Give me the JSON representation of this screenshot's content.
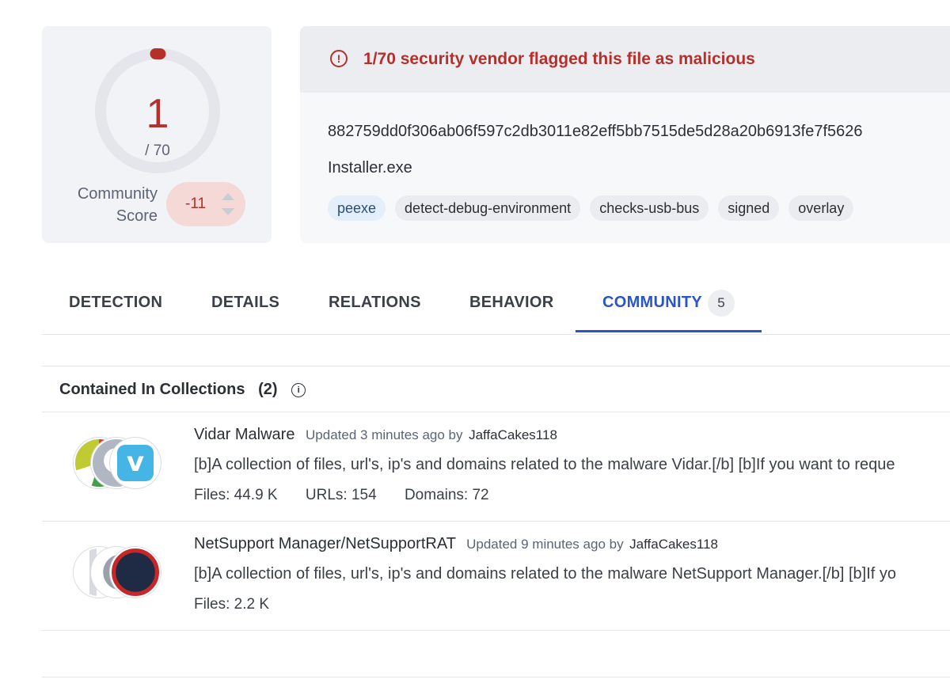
{
  "score": {
    "detections": "1",
    "total": "/ 70",
    "community_label": "Community Score",
    "community_value": "-11",
    "accent_color": "#b5302b"
  },
  "alert": {
    "icon": "alert-circle-icon",
    "text": "1/70 security vendor flagged this file as malicious"
  },
  "file": {
    "hash": "882759dd0f306ab06f597c2db3011e82eff5bb7515de5d28a20b6913fe7f5626",
    "name": "Installer.exe",
    "tags": [
      "peexe",
      "detect-debug-environment",
      "checks-usb-bus",
      "signed",
      "overlay"
    ]
  },
  "tabs": {
    "detection": "DETECTION",
    "details": "DETAILS",
    "relations": "RELATIONS",
    "behavior": "BEHAVIOR",
    "community": "COMMUNITY",
    "community_count": "5",
    "active": "COMMUNITY"
  },
  "collections": {
    "header": "Contained In Collections",
    "count": "(2)",
    "items": [
      {
        "name": "Vidar Malware",
        "updated": "Updated 3 minutes ago by",
        "author": "JaffaCakes118",
        "description": "[b]A collection of files, url's, ip's and domains related to the malware Vidar.[/b] [b]If you want to reque",
        "files": "Files: 44.9 K",
        "urls": "URLs: 154",
        "domains": "Domains: 72"
      },
      {
        "name": "NetSupport Manager/NetSupportRAT",
        "updated": "Updated 9 minutes ago by",
        "author": "JaffaCakes118",
        "description": "[b]A collection of files, url's, ip's and domains related to the malware NetSupport Manager.[/b] [b]If yo",
        "files": "Files: 2.2 K"
      }
    ]
  }
}
